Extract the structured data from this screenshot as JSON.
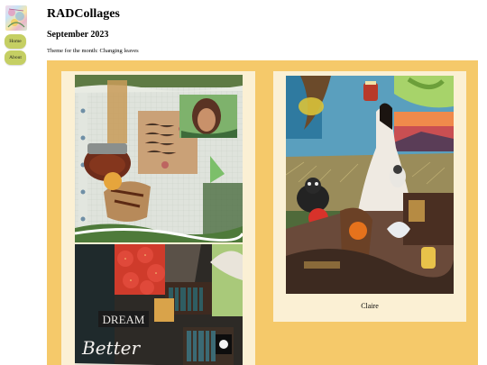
{
  "site": {
    "title": "RADCollages"
  },
  "nav": {
    "items": [
      {
        "label": "Home"
      },
      {
        "label": "About"
      }
    ]
  },
  "page": {
    "heading": "September 2023",
    "theme": "Theme for the month: Changing leaves"
  },
  "gallery": {
    "items": [
      {
        "caption": "",
        "collage_text": []
      },
      {
        "caption": "",
        "collage_text": [
          "DREAM",
          "Better"
        ]
      },
      {
        "caption": "Claire",
        "collage_text": []
      }
    ]
  },
  "colors": {
    "nav_button": "#c5cf63",
    "gallery_background": "#f5c96a",
    "card_background": "#fbf0d4"
  }
}
